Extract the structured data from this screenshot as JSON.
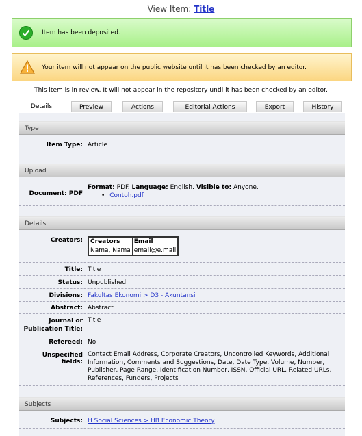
{
  "header": {
    "prefix": "View Item:",
    "title_link": "Title"
  },
  "messages": {
    "deposited": "Item has been deposited.",
    "warning": "Your item will not appear on the public website until it has been checked by an editor."
  },
  "review_note": "This item is in review. It will not appear in the repository until it has been checked by an editor.",
  "tabs": [
    {
      "label": "Details",
      "active": true
    },
    {
      "label": "Preview"
    },
    {
      "label": "Actions"
    },
    {
      "label": "Editorial Actions"
    },
    {
      "label": "Export"
    },
    {
      "label": "History"
    }
  ],
  "sections": {
    "type": "Type",
    "upload": "Upload",
    "details": "Details",
    "subjects": "Subjects"
  },
  "type_section": {
    "label": "Item Type:",
    "value": "Article"
  },
  "upload_section": {
    "label": "Document: PDF",
    "format_label": "Format:",
    "format_value": "PDF.",
    "language_label": "Language:",
    "language_value": "English.",
    "visible_label": "Visible to:",
    "visible_value": "Anyone.",
    "file_link": "Contoh.pdf"
  },
  "details_section": {
    "creators_label": "Creators:",
    "creators_headers": [
      "Creators",
      "Email"
    ],
    "creators_row": [
      "Nama, Nama",
      "email@e.mail"
    ],
    "title_label": "Title:",
    "title_value": "Title",
    "status_label": "Status:",
    "status_value": "Unpublished",
    "divisions_label": "Divisions:",
    "divisions_value": "Fakultas Ekonomi > D3 - Akuntansi",
    "abstract_label": "Abstract:",
    "abstract_value": "Abstract",
    "journal_label_1": "Journal or",
    "journal_label_2": "Publication Title:",
    "journal_value": "Title",
    "refereed_label": "Refereed:",
    "refereed_value": "No",
    "unspecified_label": "Unspecified fields:",
    "unspecified_value": "Contact Email Address, Corporate Creators, Uncontrolled Keywords, Additional Information, Comments and Suggestions, Date, Date Type, Volume, Number, Publisher, Page Range, Identification Number, ISSN, Official URL, Related URLs, References, Funders, Projects"
  },
  "subjects_section": {
    "label": "Subjects:",
    "value": "H Social Sciences > HB Economic Theory"
  }
}
